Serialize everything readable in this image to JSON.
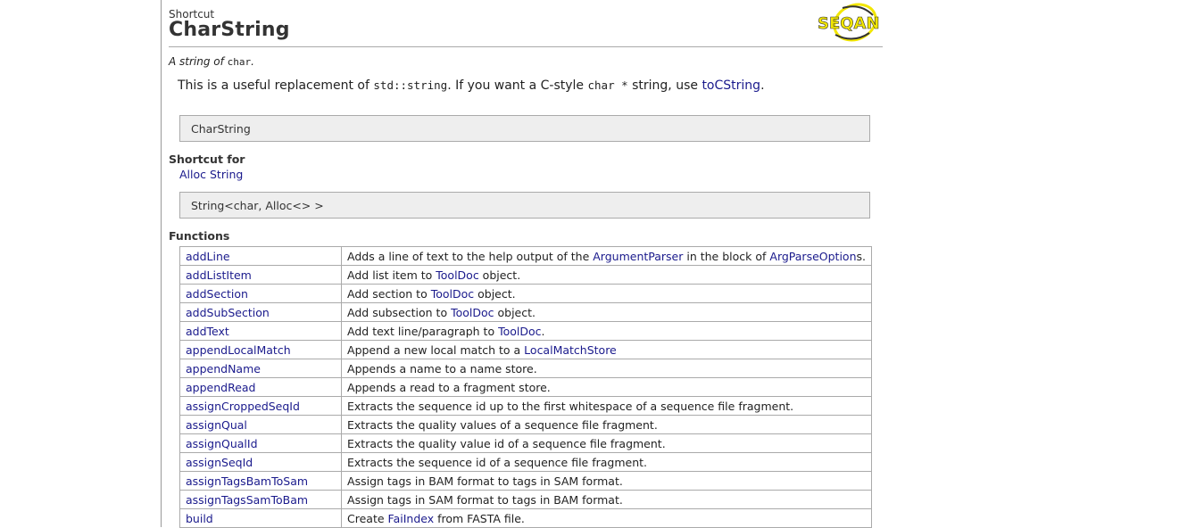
{
  "header": {
    "kind": "Shortcut",
    "title": "CharString",
    "logo_text": "SEQAN"
  },
  "brief": {
    "prefix": "A string of ",
    "code": "char",
    "suffix": "."
  },
  "description": {
    "part1": "This is a useful replacement of ",
    "code1": "std::string",
    "part2": ". If you want a C-style ",
    "code2": "char *",
    "part3": " string, use ",
    "link": "toCString",
    "part4": "."
  },
  "signature": "CharString",
  "shortcut_for": {
    "heading": "Shortcut for",
    "link": "Alloc String",
    "code": "String<char, Alloc<> >"
  },
  "functions": {
    "heading": "Functions",
    "rows": [
      {
        "name": "addLine",
        "desc": [
          {
            "t": "Adds a line of text to the help output of the "
          },
          {
            "l": "ArgumentParser"
          },
          {
            "t": " in the block of "
          },
          {
            "l": "ArgParseOption"
          },
          {
            "t": "s."
          }
        ]
      },
      {
        "name": "addListItem",
        "desc": [
          {
            "t": "Add list item to "
          },
          {
            "l": "ToolDoc"
          },
          {
            "t": " object."
          }
        ]
      },
      {
        "name": "addSection",
        "desc": [
          {
            "t": "Add section to "
          },
          {
            "l": "ToolDoc"
          },
          {
            "t": " object."
          }
        ]
      },
      {
        "name": "addSubSection",
        "desc": [
          {
            "t": "Add subsection to "
          },
          {
            "l": "ToolDoc"
          },
          {
            "t": " object."
          }
        ]
      },
      {
        "name": "addText",
        "desc": [
          {
            "t": "Add text line/paragraph to "
          },
          {
            "l": "ToolDoc"
          },
          {
            "t": "."
          }
        ]
      },
      {
        "name": "appendLocalMatch",
        "desc": [
          {
            "t": "Append a new local match to a "
          },
          {
            "l": "LocalMatchStore"
          }
        ]
      },
      {
        "name": "appendName",
        "desc": [
          {
            "t": "Appends a name to a name store."
          }
        ]
      },
      {
        "name": "appendRead",
        "desc": [
          {
            "t": "Appends a read to a fragment store."
          }
        ]
      },
      {
        "name": "assignCroppedSeqId",
        "desc": [
          {
            "t": "Extracts the sequence id up to the first whitespace of a sequence file fragment."
          }
        ]
      },
      {
        "name": "assignQual",
        "desc": [
          {
            "t": "Extracts the quality values of a sequence file fragment."
          }
        ]
      },
      {
        "name": "assignQualId",
        "desc": [
          {
            "t": "Extracts the quality value id of a sequence file fragment."
          }
        ]
      },
      {
        "name": "assignSeqId",
        "desc": [
          {
            "t": "Extracts the sequence id of a sequence file fragment."
          }
        ]
      },
      {
        "name": "assignTagsBamToSam",
        "desc": [
          {
            "t": "Assign tags in BAM format to tags in SAM format."
          }
        ]
      },
      {
        "name": "assignTagsSamToBam",
        "desc": [
          {
            "t": "Assign tags in SAM format to tags in BAM format."
          }
        ]
      },
      {
        "name": "build",
        "desc": [
          {
            "t": "Create "
          },
          {
            "l": "FaiIndex"
          },
          {
            "t": " from FASTA file."
          }
        ]
      }
    ]
  },
  "colors": {
    "link": "#1a1a8c",
    "logo_yellow": "#f2e600",
    "box_bg": "#eeeeee"
  }
}
